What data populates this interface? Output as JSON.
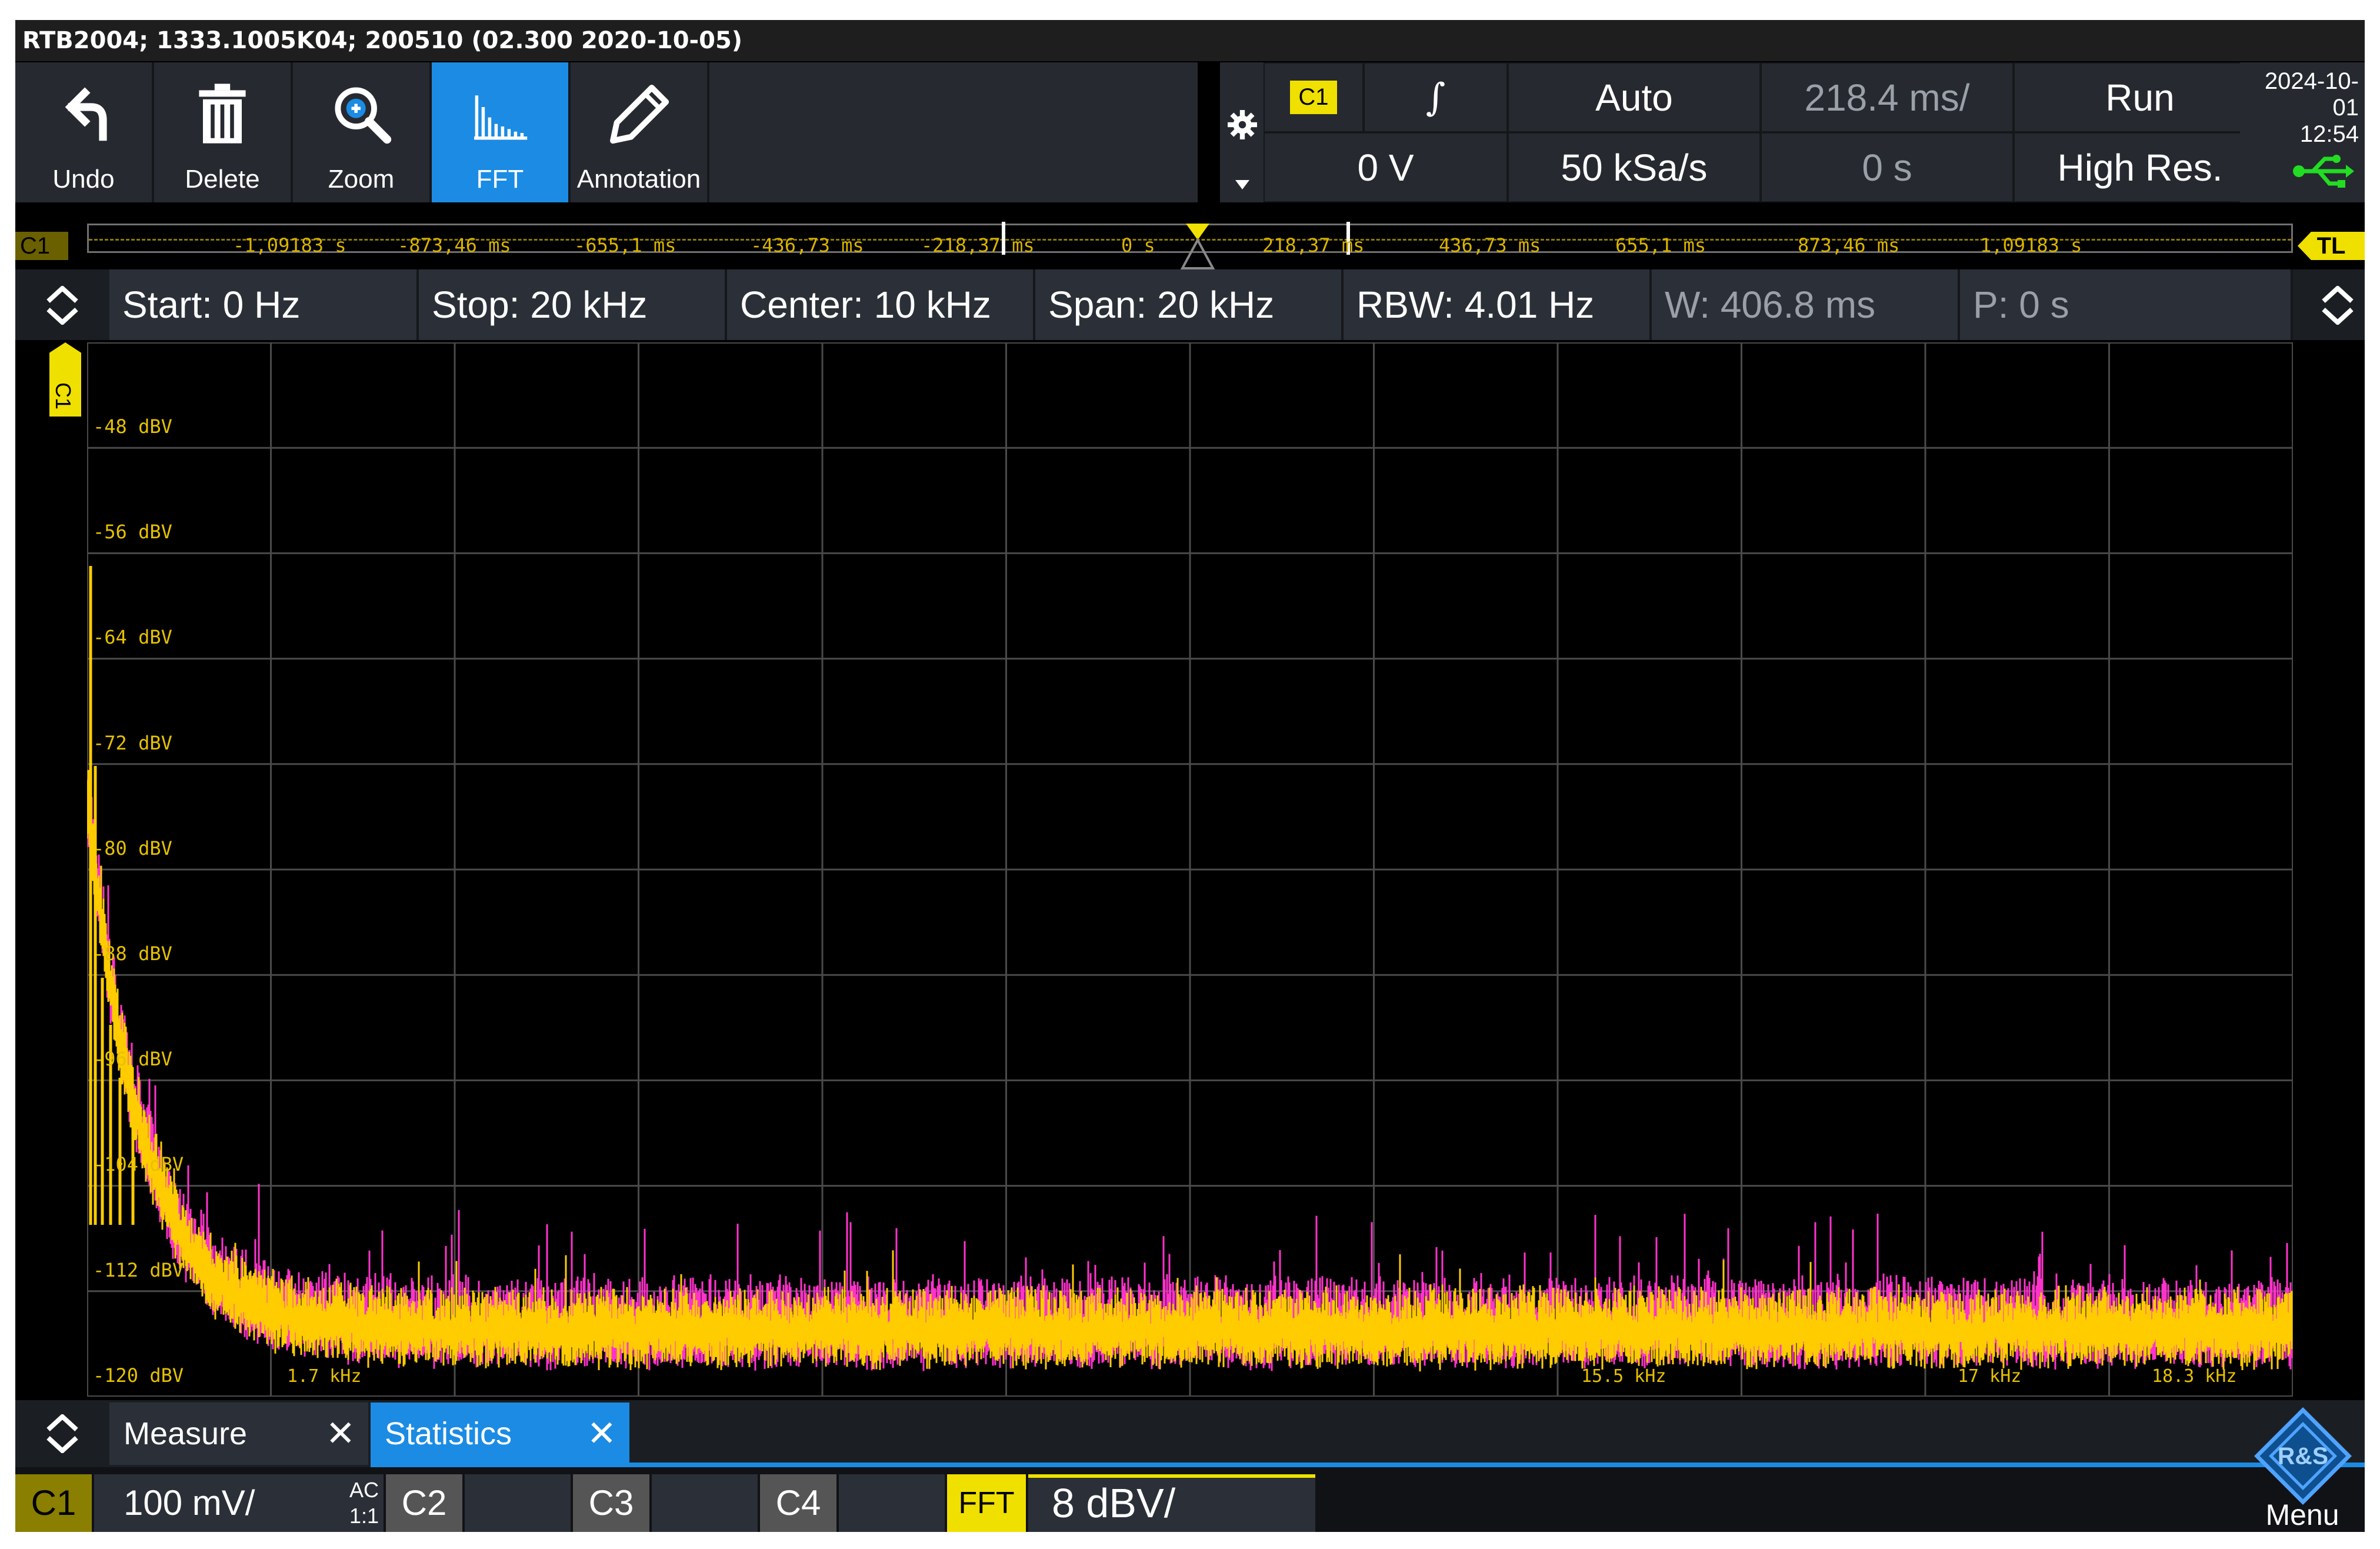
{
  "window": {
    "title": "RTB2004; 1333.1005K04; 200510 (02.300 2020-10-05)"
  },
  "toolbar": {
    "undo_label": "Undo",
    "delete_label": "Delete",
    "zoom_label": "Zoom",
    "fft_label": "FFT",
    "annotation_label": "Annotation"
  },
  "status": {
    "trigger_source": "C1",
    "trigger_slope_symbol": "∫",
    "trigger_mode": "Auto",
    "time_scale": "218.4 ms/",
    "run_state": "Run",
    "trigger_level": "0 V",
    "sample_rate": "50 kSa/s",
    "time_offset": "0 s",
    "acq_mode": "High Res.",
    "date": "2024-10-01",
    "time": "12:54"
  },
  "timebase": {
    "channel_tag": "C1",
    "right_tag": "TL",
    "labels": [
      "-1,09183 s",
      "-873,46 ms",
      "-655,1 ms",
      "-436,73 ms",
      "-218,37 ms",
      "0 s",
      "218,37 ms",
      "436,73 ms",
      "655,1 ms",
      "873,46 ms",
      "1,09183 s"
    ]
  },
  "fft_settings": {
    "start": "Start: 0 Hz",
    "stop": "Stop: 20 kHz",
    "center": "Center: 10 kHz",
    "span": "Span: 20 kHz",
    "rbw": "RBW: 4.01 Hz",
    "window": "W: 406.8 ms",
    "position": "P: 0 s"
  },
  "plot": {
    "channel_marker": "C1",
    "y_labels": [
      "-48 dBV",
      "-56 dBV",
      "-64 dBV",
      "-72 dBV",
      "-80 dBV",
      "-88 dBV",
      "-96 dBV",
      "-104 dBV",
      "-112 dBV",
      "-120 dBV"
    ],
    "x_labels": [
      "1.7 kHz",
      "15.5 kHz",
      "17 kHz",
      "18.3 kHz"
    ],
    "colors": {
      "trace_primary": "#ffcc00",
      "trace_secondary": "#ff33cc",
      "grid": "#4a4a4a",
      "label": "#e6c100"
    }
  },
  "bottom_tabs": {
    "measure_label": "Measure",
    "statistics_label": "Statistics"
  },
  "channels": {
    "c1_label": "C1",
    "c1_scale": "100 mV/",
    "c1_coupling": "AC",
    "c1_probe": "1:1",
    "c2_label": "C2",
    "c3_label": "C3",
    "c4_label": "C4",
    "fft_label": "FFT",
    "fft_scale": "8 dBV/",
    "menu_label": "Menu",
    "logo_text": "R&S"
  },
  "colors": {
    "accent_blue": "#1b8be4",
    "channel_yellow": "#f0e000",
    "usb_green": "#22dd22"
  }
}
